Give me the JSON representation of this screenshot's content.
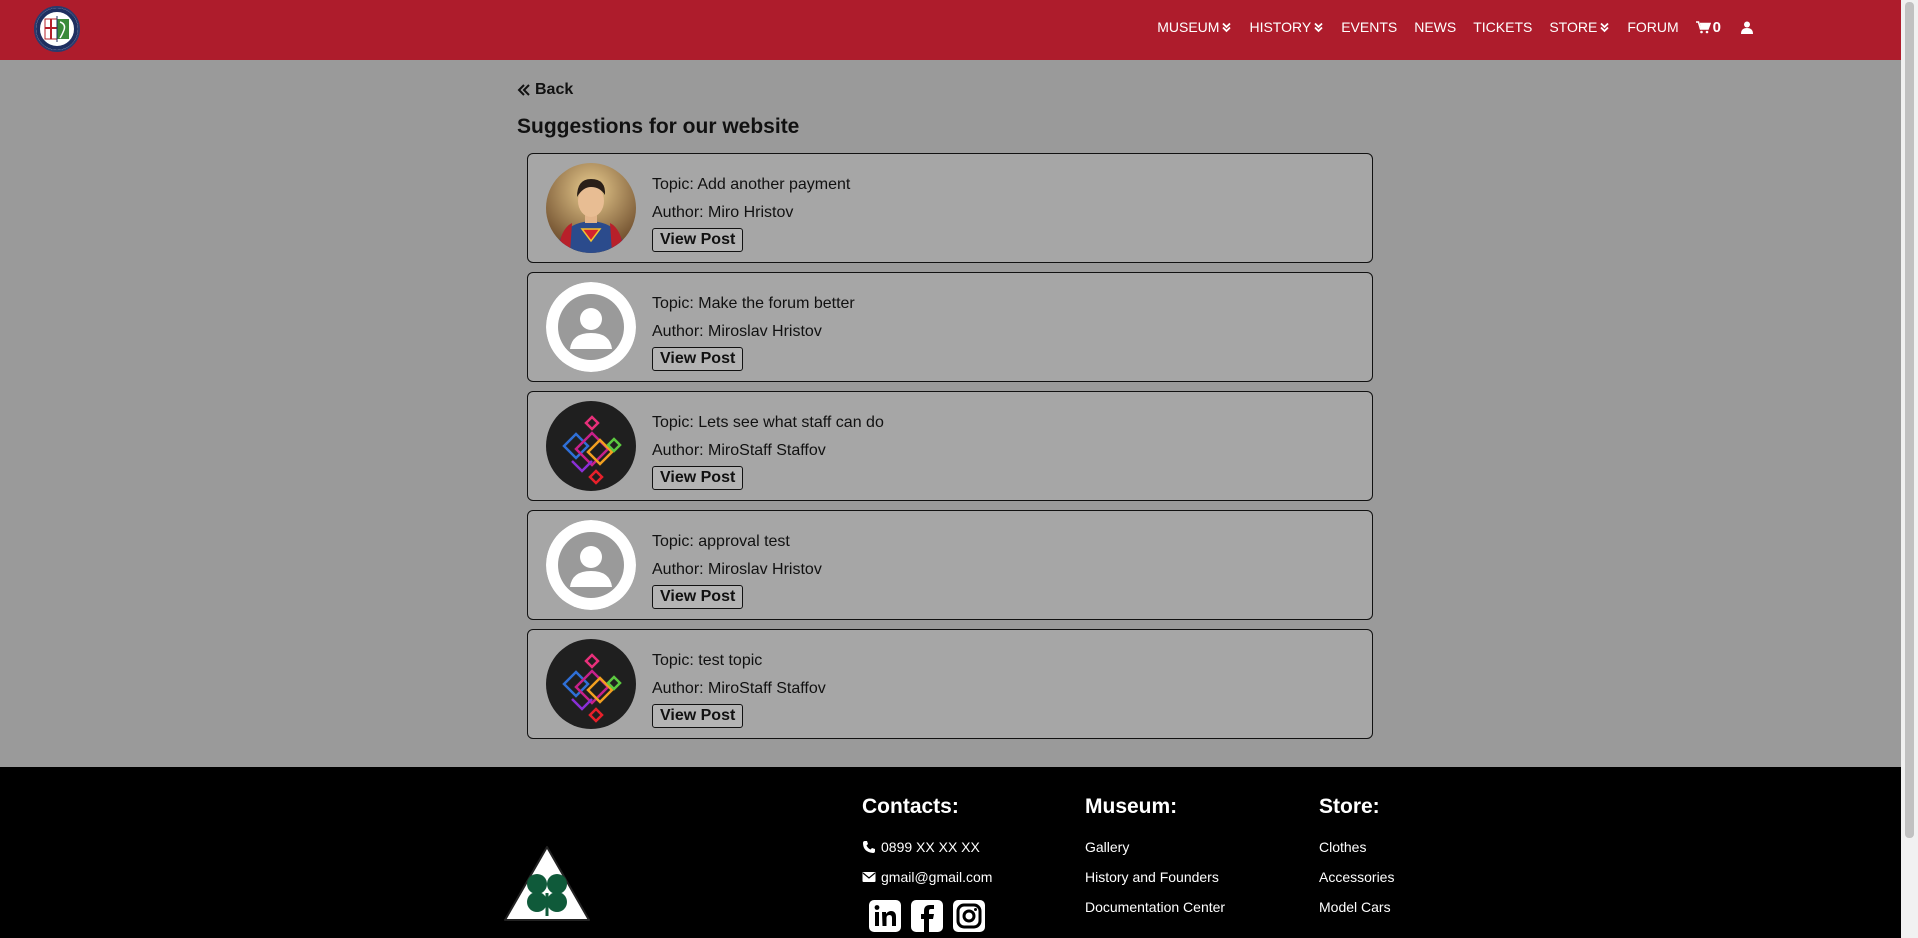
{
  "nav": {
    "items": [
      {
        "label": "MUSEUM",
        "dropdown": true
      },
      {
        "label": "HISTORY",
        "dropdown": true
      },
      {
        "label": "EVENTS",
        "dropdown": false
      },
      {
        "label": "NEWS",
        "dropdown": false
      },
      {
        "label": "TICKETS",
        "dropdown": false
      },
      {
        "label": "STORE",
        "dropdown": true
      },
      {
        "label": "FORUM",
        "dropdown": false
      }
    ],
    "cart_count": "0",
    "cart_icon": "shopping-cart-icon",
    "user_icon": "user-icon"
  },
  "page": {
    "back_label": "Back",
    "title": "Suggestions for our website"
  },
  "posts": [
    {
      "topic": "Topic: Add another payment",
      "author": "Author: Miro Hristov",
      "button": "View Post",
      "avatar": "superman"
    },
    {
      "topic": "Topic: Make the forum better",
      "author": "Author: Miroslav Hristov",
      "button": "View Post",
      "avatar": "default"
    },
    {
      "topic": "Topic: Lets see what staff can do",
      "author": "Author: MiroStaff Staffov",
      "button": "View Post",
      "avatar": "diamonds"
    },
    {
      "topic": "Topic: approval test",
      "author": "Author: Miroslav Hristov",
      "button": "View Post",
      "avatar": "default"
    },
    {
      "topic": "Topic: test topic",
      "author": "Author: MiroStaff Staffov",
      "button": "View Post",
      "avatar": "diamonds"
    }
  ],
  "footer": {
    "contacts": {
      "title": "Contacts:",
      "phone": "0899 XX XX XX",
      "email": "gmail@gmail.com"
    },
    "museum": {
      "title": "Museum:",
      "links": [
        "Gallery",
        "History and Founders",
        "Documentation Center"
      ]
    },
    "store": {
      "title": "Store:",
      "links": [
        "Clothes",
        "Accessories",
        "Model Cars"
      ]
    },
    "social_icons": [
      "linkedin-icon",
      "facebook-icon",
      "instagram-icon"
    ]
  },
  "colors": {
    "navbar": "#ae1c2c",
    "page_bg": "#9a9a9a",
    "card_bg": "#a6a6a6",
    "footer": "#000000"
  }
}
